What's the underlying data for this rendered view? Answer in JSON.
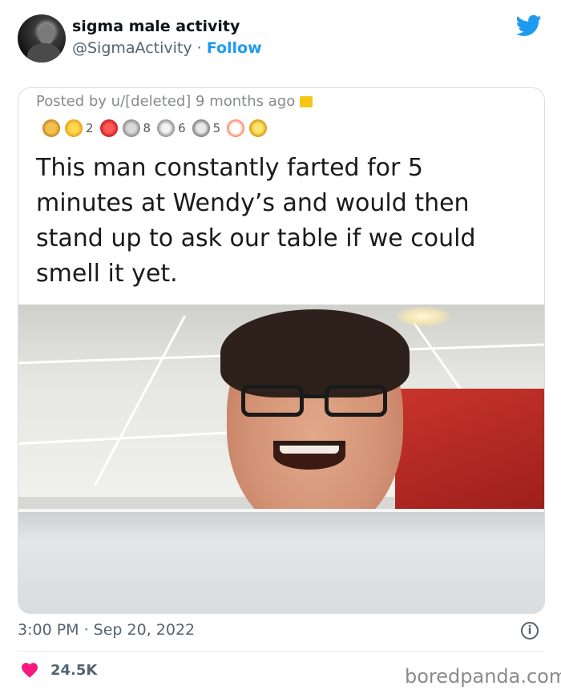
{
  "header": {
    "display_name": "sigma male activity",
    "handle": "@SigmaActivity",
    "separator": " · ",
    "follow_label": "Follow"
  },
  "post": {
    "posted_by": "Posted by u/[deleted] 9 months ago",
    "awards": [
      {
        "icon": "trophy-award-icon"
      },
      {
        "icon": "gold-award-icon",
        "count": "2"
      },
      {
        "icon": "heart-eyes-award-icon"
      },
      {
        "icon": "silver-award-icon",
        "count": "8"
      },
      {
        "icon": "wholesome-award-icon",
        "count": "6"
      },
      {
        "icon": "money-award-icon",
        "count": "5"
      },
      {
        "icon": "snoo-award-icon"
      },
      {
        "icon": "sun-award-icon"
      }
    ],
    "text": "This man constantly farted for 5 minutes at Wendy’s and would then stand up to ask our table if we could smell it yet."
  },
  "footer": {
    "timestamp": "3:00 PM · Sep 20, 2022",
    "likes": "24.5K",
    "watermark": "boredpanda.com"
  },
  "colors": {
    "accent": "#1d9bf0",
    "like": "#f91880",
    "muted": "#536471"
  }
}
